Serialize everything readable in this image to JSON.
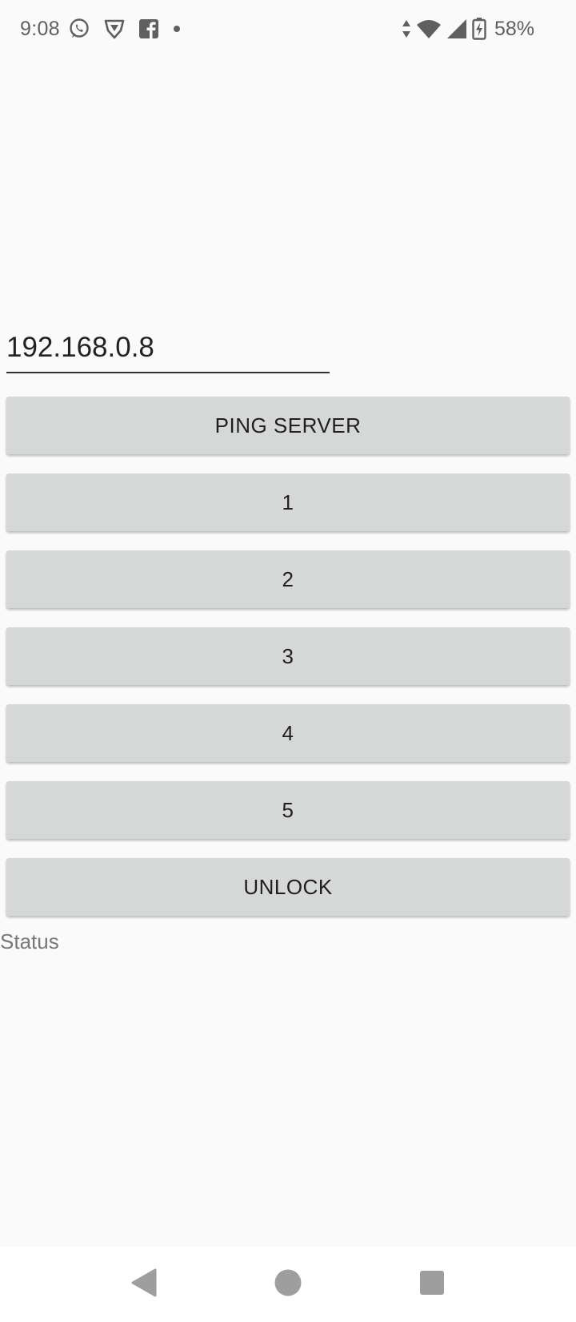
{
  "status_bar": {
    "time": "9:08",
    "battery_percent": "58%",
    "left_icons": [
      "whatsapp-icon",
      "vpn-shield-icon",
      "facebook-icon",
      "notification-dot-icon"
    ],
    "right_icons": [
      "data-arrows-icon",
      "wifi-icon",
      "cell-signal-icon",
      "battery-charging-icon"
    ]
  },
  "ip_input": {
    "value": "192.168.0.8"
  },
  "buttons": {
    "ping": "PING SERVER",
    "b1": "1",
    "b2": "2",
    "b3": "3",
    "b4": "4",
    "b5": "5",
    "unlock": "UNLOCK"
  },
  "status_text": "Status",
  "nav_bar": {
    "icons": [
      "back-icon",
      "home-icon",
      "recents-icon"
    ]
  },
  "colors": {
    "background": "#fafafa",
    "button": "#d6d7d7",
    "nav_icon": "#9e9e9e"
  }
}
